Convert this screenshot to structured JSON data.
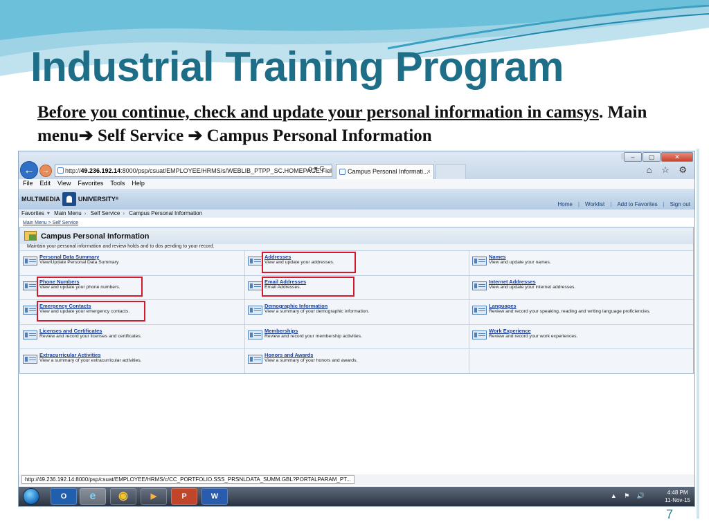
{
  "slide": {
    "title": "Industrial Training Program",
    "subtitle_underlined": "Before you continue, check and update your personal information in camsys",
    "subtitle_rest": ". Main menu",
    "path_step_1": " Self Service ",
    "path_step_2": " Campus Personal Information",
    "arrow_glyph": "➔",
    "page_number": "7",
    "accent_color": "#1f6e87"
  },
  "browser": {
    "address": {
      "prefix": "http://",
      "domain": "49.236.192.14",
      "rest": ":8000/psp/csuat/EMPLOYEE/HRMS/s/WEBLIB_PTPP_SC.HOMEPAGE.Fiel",
      "tools": "ρ ▾ C"
    },
    "tab_label": "Campus Personal Informati...",
    "tab_close": "×",
    "nav_back_glyph": "←",
    "nav_forward_glyph": "→",
    "window_buttons": {
      "minimize": "‒",
      "restore": "▢",
      "close": "✕"
    },
    "toolbar_icons": "⌂ ☆ ⚙",
    "menu": [
      "File",
      "Edit",
      "View",
      "Favorites",
      "Tools",
      "Help"
    ],
    "status_url": "http://49.236.192.14:8000/psp/csuat/EMPLOYEE/HRMS/c/CC_PORTFOLIO.SSS_PRSNLDATA_SUMM.GBL?PORTALPARAM_PT..."
  },
  "peoplesoft": {
    "logo_left": "MULTIMEDIA",
    "logo_right": "UNIVERSITY",
    "logo_reg": "®",
    "header_links": [
      "Home",
      "Worklist",
      "Add to Favorites",
      "Sign out"
    ],
    "pagebar": [
      "Favorites",
      "Main Menu",
      "Self Service",
      "Campus Personal Information"
    ],
    "breadcrumb": [
      "Main Menu",
      "Self Service"
    ],
    "breadcrumb_sep": " > ",
    "panel_title": "Campus Personal Information",
    "panel_description": "Maintain your personal information and review holds and to dos pending to your record.",
    "grid": [
      [
        {
          "link": "Personal Data Summary",
          "desc": "View/Update Personal Data Summary",
          "highlight": false
        },
        {
          "link": "Addresses",
          "desc": "View and update your addresses.",
          "highlight": true
        },
        {
          "link": "Names",
          "desc": "View and update your names.",
          "highlight": false
        }
      ],
      [
        {
          "link": "Phone Numbers",
          "desc": "View and update your phone numbers.",
          "highlight": true
        },
        {
          "link": "Email Addresses",
          "desc": "Email Addresses.",
          "highlight": true
        },
        {
          "link": "Internet Addresses",
          "desc": "View and update your internet addresses.",
          "highlight": false
        }
      ],
      [
        {
          "link": "Emergency Contacts",
          "desc": "View and update your emergency contacts.",
          "highlight": true
        },
        {
          "link": "Demographic Information",
          "desc": "View a summary of your demographic information.",
          "highlight": false
        },
        {
          "link": "Languages",
          "desc": "Review and record your speaking, reading and writing language proficiencies.",
          "highlight": false
        }
      ],
      [
        {
          "link": "Licenses and Certificates",
          "desc": "Review and record your licenses and certificates.",
          "highlight": false
        },
        {
          "link": "Memberships",
          "desc": "Review and record your membership activities.",
          "highlight": false
        },
        {
          "link": "Work Experience",
          "desc": "Review and record your work experiences.",
          "highlight": false
        }
      ],
      [
        {
          "link": "Extracurricular Activities",
          "desc": "View a summary of your extracurricular activities.",
          "highlight": false
        },
        {
          "link": "Honors and Awards",
          "desc": "View a summary of your honors and awards.",
          "highlight": false
        },
        {
          "link": "",
          "desc": "",
          "highlight": false
        }
      ]
    ],
    "highlight_color": "#d3192b"
  },
  "taskbar": {
    "apps": [
      {
        "name": "outlook-icon",
        "label": "O"
      },
      {
        "name": "internet-explorer-icon",
        "label": "e",
        "active": true
      },
      {
        "name": "chrome-icon",
        "label": "◉"
      },
      {
        "name": "media-player-icon",
        "label": "▶"
      },
      {
        "name": "powerpoint-icon",
        "label": "P"
      },
      {
        "name": "word-icon",
        "label": "W"
      }
    ],
    "tray_icons": "▲ ⚑ 🔊",
    "time": "4:48 PM",
    "date": "11-Nov-15"
  }
}
